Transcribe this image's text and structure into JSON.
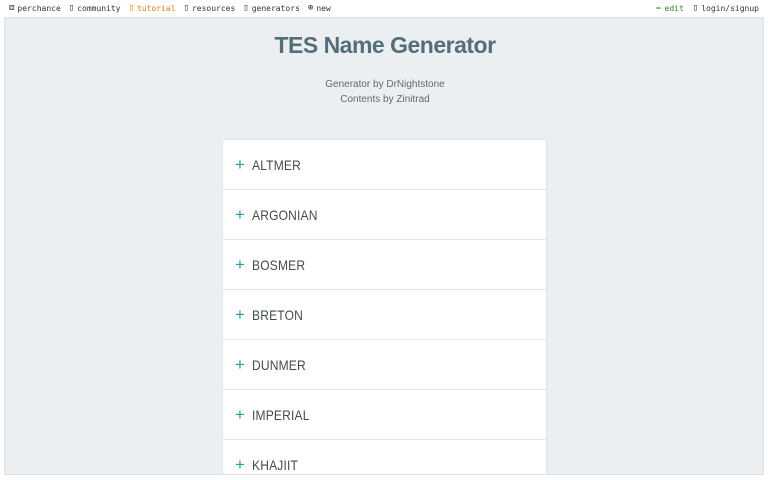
{
  "topbar": {
    "left": [
      {
        "icon": "dice-icon",
        "glyph": "⚄",
        "label": "perchance"
      },
      {
        "icon": "community-icon",
        "glyph": "▯",
        "label": "community"
      },
      {
        "icon": "tutorial-icon",
        "glyph": "▯",
        "label": "tutorial"
      },
      {
        "icon": "resources-icon",
        "glyph": "▯",
        "label": "resources"
      },
      {
        "icon": "generators-icon",
        "glyph": "▯",
        "label": "generators"
      },
      {
        "icon": "new-icon",
        "glyph": "⊕",
        "label": "new"
      }
    ],
    "right": [
      {
        "icon": "pencil-icon",
        "glyph": "✏",
        "label": "edit"
      },
      {
        "icon": "user-icon",
        "glyph": "▯",
        "label": "login/signup"
      }
    ],
    "accent_color": "#e07d10",
    "edit_color": "#2a8a2a"
  },
  "page": {
    "title": "TES Name Generator",
    "credit_line_1": "Generator by DrNightstone",
    "credit_line_2": "Contents by Zinitrad"
  },
  "accordion": {
    "expand_glyph": "+",
    "items": [
      "ALTMER",
      "ARGONIAN",
      "BOSMER",
      "BRETON",
      "DUNMER",
      "IMPERIAL",
      "KHAJIIT"
    ]
  },
  "colors": {
    "background": "#eceff1",
    "title": "#546e7a",
    "plus": "#1f9bb0"
  }
}
